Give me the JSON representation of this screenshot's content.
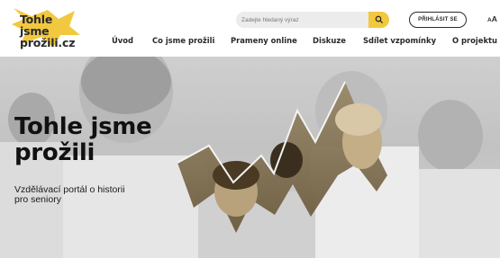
{
  "logo": {
    "line1": "Tohle jsme",
    "line2": "prožili.cz",
    "accent_color": "#f2c83e"
  },
  "search": {
    "placeholder": "Zadejte hledaný výraz",
    "value": "",
    "button_icon": "search-icon",
    "button_color": "#f2c83e"
  },
  "header": {
    "login_label": "PŘIHLÁSIT SE",
    "font_size_toggle": {
      "small": "A",
      "large": "A"
    }
  },
  "nav": {
    "items": [
      "Úvod",
      "Co jsme prožili",
      "Prameny online",
      "Diskuze",
      "Sdílet vzpomínky",
      "O projektu"
    ]
  },
  "hero": {
    "title": "Tohle jsme prožili",
    "subtitle": "Vzdělávací portál o historii pro seniory",
    "image": "black-and-white-photo-children-in-uniforms",
    "accent_color": "#5c4a2a"
  }
}
